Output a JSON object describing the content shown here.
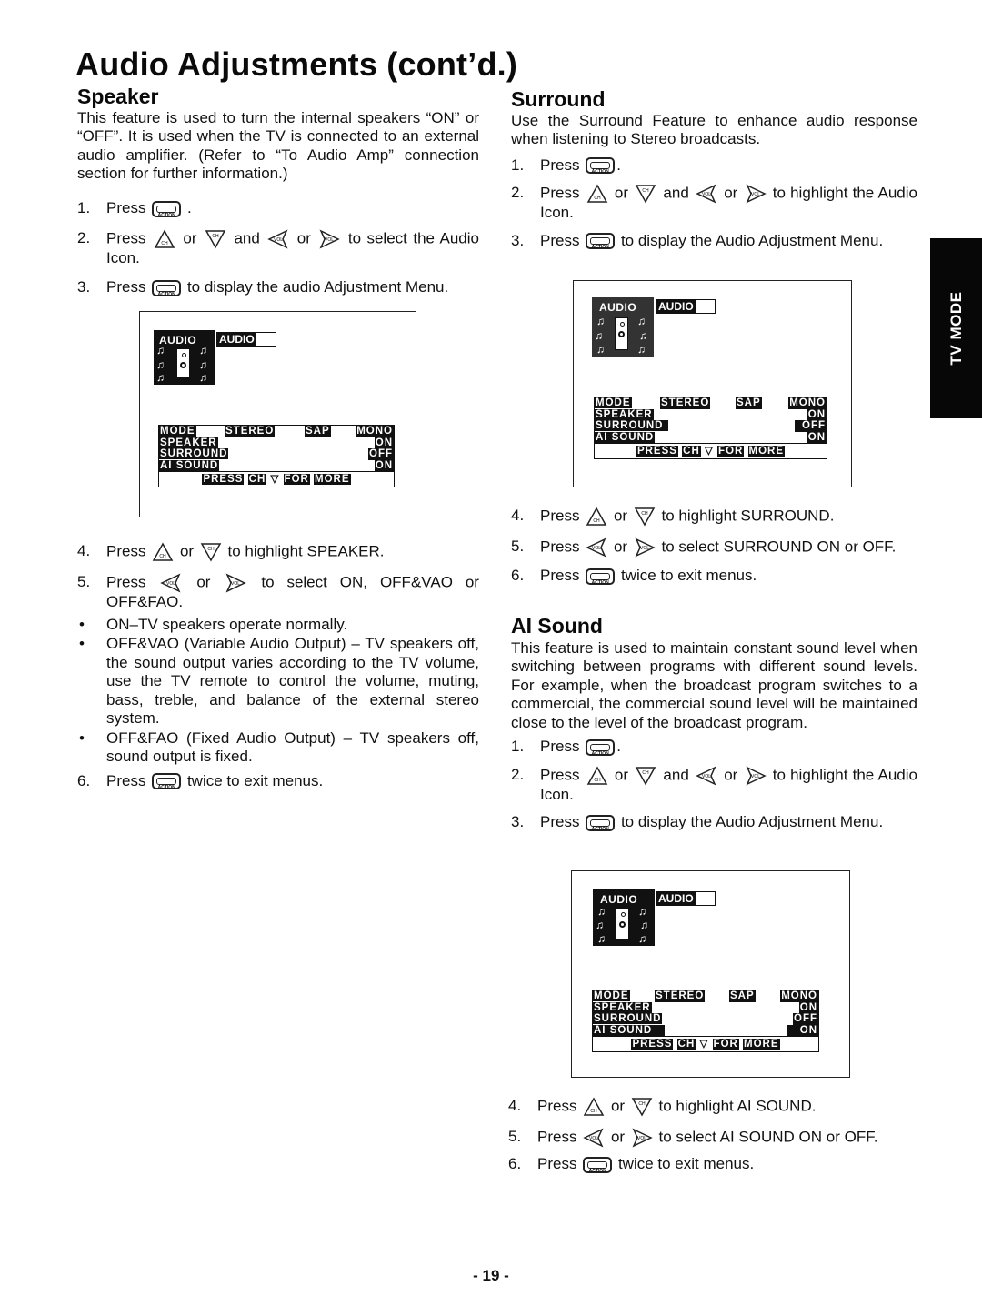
{
  "page": {
    "title": "Audio Adjustments (cont’d.)",
    "side_tab": "TV MODE",
    "page_number": "- 19 -"
  },
  "icons": {
    "action_button": "action-button-icon",
    "ch_up": "ch-up-icon",
    "ch_down": "ch-down-icon",
    "vol_left": "vol-left-icon",
    "vol_right": "vol-right-icon",
    "action_text": "ACTION",
    "ch_text": "CH",
    "vol_text": "VOL"
  },
  "speaker": {
    "heading": "Speaker",
    "intro": "This feature is used to turn the internal speakers “ON” or “OFF”. It is used when the TV is connected to an external audio amplifier. (Refer to “To Audio Amp” connection section for further information.)",
    "steps": [
      {
        "num": "1.",
        "pre": "Press",
        "post": "."
      },
      {
        "num": "2.",
        "pre": "Press",
        "or1": "or",
        "and": "and",
        "or2": "or",
        "post": "to select the Audio Icon."
      },
      {
        "num": "3.",
        "pre": "Press",
        "post": "to display the audio Adjustment Menu."
      },
      {
        "num": "4.",
        "pre": "Press",
        "or1": "or",
        "post": "to highlight SPEAKER."
      },
      {
        "num": "5.",
        "pre": "Press",
        "or1": "or",
        "post": "to select ON, OFF&VAO or OFF&FAO."
      },
      {
        "num": "6.",
        "pre": "Press",
        "post": "twice to exit menus."
      }
    ],
    "bullets": [
      "ON–TV speakers operate normally.",
      "OFF&VAO    (Variable Audio Output)  – TV speakers off, the sound output varies according to the TV volume, use the TV remote to control the volume, muting, bass, treble, and balance of the external stereo system.",
      "OFF&FAO (Fixed Audio Output) – TV speakers off, sound output is fixed."
    ],
    "screen": {
      "icon_title": "AUDIO",
      "label": "AUDIO",
      "highlight": "SPEAKER"
    }
  },
  "surround": {
    "heading": "Surround",
    "intro": "Use the Surround Feature to enhance audio response when listening to Stereo broadcasts.",
    "steps": [
      {
        "num": "1.",
        "pre": "Press",
        "post": "."
      },
      {
        "num": "2.",
        "pre": "Press",
        "or1": "or",
        "and": "and",
        "or2": "or",
        "post": "to highlight the Audio Icon."
      },
      {
        "num": "3.",
        "pre": "Press",
        "post": "to display the Audio Adjustment Menu."
      },
      {
        "num": "4.",
        "pre": "Press",
        "or1": "or",
        "post": "to highlight SURROUND."
      },
      {
        "num": "5.",
        "pre": "Press",
        "or1": "or",
        "post": "to select SURROUND ON or OFF."
      },
      {
        "num": "6.",
        "pre": "Press",
        "post": "twice to exit menus."
      }
    ],
    "screen": {
      "icon_title": "AUDIO",
      "label": "AUDIO",
      "highlight": "SURROUND"
    }
  },
  "ai_sound": {
    "heading": "AI Sound",
    "intro": "This feature is used to maintain constant sound level when switching between programs with different sound levels. For example, when the broadcast program switches to a commercial, the commercial sound level will be maintained close to the level of the broadcast program.",
    "steps": [
      {
        "num": "1.",
        "pre": "Press",
        "post": "."
      },
      {
        "num": "2.",
        "pre": "Press",
        "or1": "or",
        "and": "and",
        "or2": "or",
        "post": "to highlight the Audio Icon."
      },
      {
        "num": "3.",
        "pre": "Press",
        "post": "to display the Audio Adjustment Menu."
      },
      {
        "num": "4.",
        "pre": "Press",
        "or1": "or",
        "post": "to highlight AI SOUND."
      },
      {
        "num": "5.",
        "pre": "Press",
        "or1": "or",
        "post": "to select AI SOUND ON or OFF."
      },
      {
        "num": "6.",
        "pre": "Press",
        "post": "twice to exit menus."
      }
    ],
    "screen": {
      "icon_title": "AUDIO",
      "label": "AUDIO",
      "highlight": "AI SOUND"
    }
  },
  "menu": {
    "mode_label": "MODE",
    "mode_options": [
      "STEREO",
      "SAP",
      "MONO"
    ],
    "rows": [
      {
        "label": "SPEAKER",
        "value": "ON"
      },
      {
        "label": "SURROUND",
        "value": "OFF"
      },
      {
        "label": "AI SOUND",
        "value": "ON"
      }
    ],
    "footer_press": "PRESS",
    "footer_ch": "CH",
    "footer_arrow": "▽",
    "footer_for": "FOR",
    "footer_more": "MORE"
  }
}
